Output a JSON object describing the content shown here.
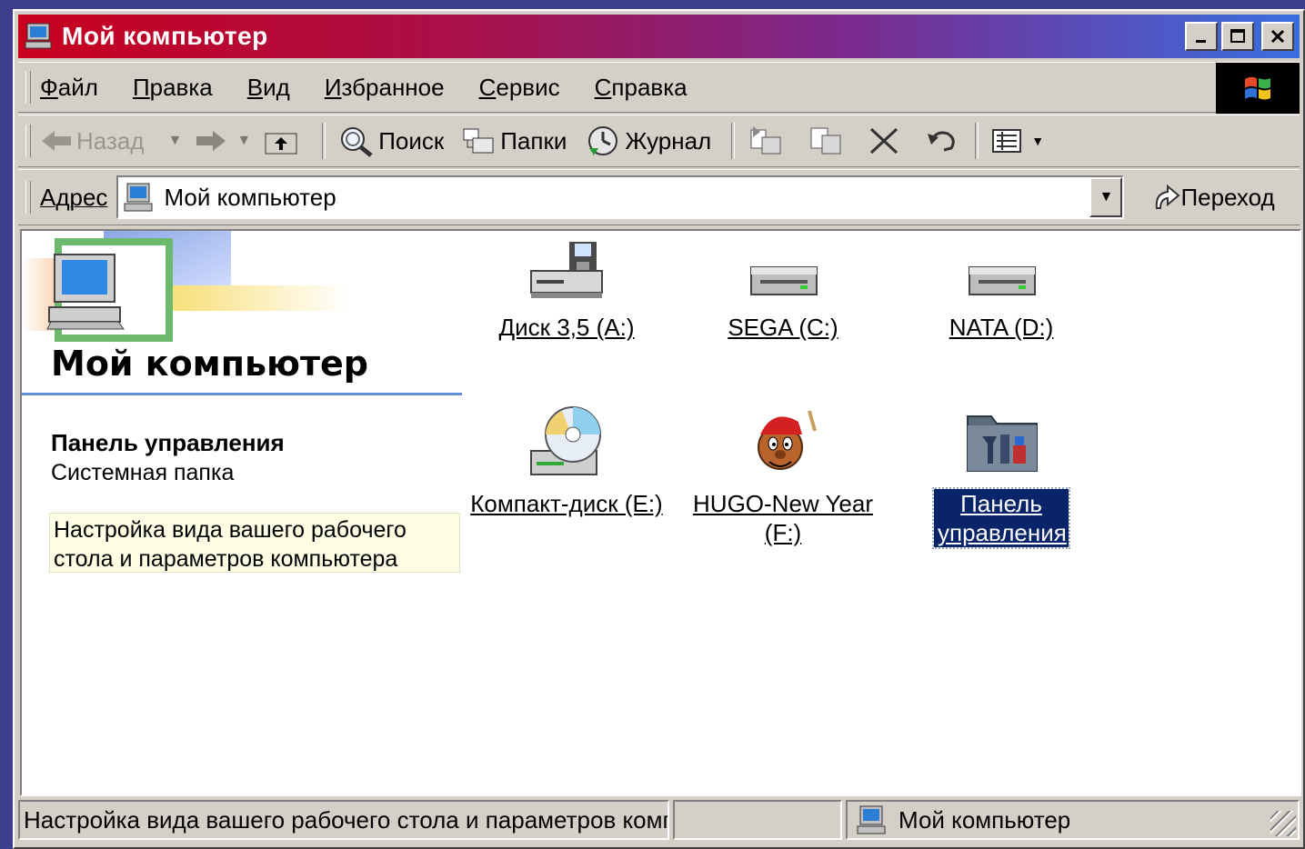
{
  "window": {
    "title": "Мой компьютер",
    "controls": [
      "minimize",
      "maximize",
      "close"
    ]
  },
  "menu": [
    {
      "key": "Ф",
      "rest": "айл"
    },
    {
      "key": "П",
      "rest": "равка"
    },
    {
      "key": "В",
      "rest": "ид"
    },
    {
      "key": "И",
      "rest": "збранное"
    },
    {
      "key": "С",
      "rest": "ервис"
    },
    {
      "key": "С",
      "rest": "правка"
    }
  ],
  "toolbar": {
    "back": "Назад",
    "search": "Поиск",
    "folders": "Папки",
    "history": "Журнал"
  },
  "address": {
    "label": "Адрес",
    "value": "Мой компьютер",
    "go": "Переход"
  },
  "left_panel": {
    "title": "Мой компьютер",
    "selected_name": "Панель управления",
    "selected_type": "Системная папка",
    "selected_desc": "Настройка вида вашего рабочего стола и параметров компьютера"
  },
  "items": [
    {
      "label": "Диск 3,5 (A:)",
      "icon": "floppy-drive-icon"
    },
    {
      "label": "SEGA (C:)",
      "icon": "hard-drive-icon"
    },
    {
      "label": "NATA (D:)",
      "icon": "hard-drive-icon"
    },
    {
      "label": "Компакт-диск (E:)",
      "icon": "cd-drive-icon"
    },
    {
      "label": "HUGO-New Year (F:)",
      "icon": "hugo-cd-icon"
    },
    {
      "label": "Панель управления",
      "icon": "control-panel-icon",
      "selected": true
    }
  ],
  "status": {
    "text": "Настройка вида вашего рабочего стола и параметров компьютера",
    "location": "Мой компьютер"
  },
  "colors": {
    "selection": "#0a246a",
    "face": "#d4d0c8",
    "desktop": "#3b3f8c"
  }
}
